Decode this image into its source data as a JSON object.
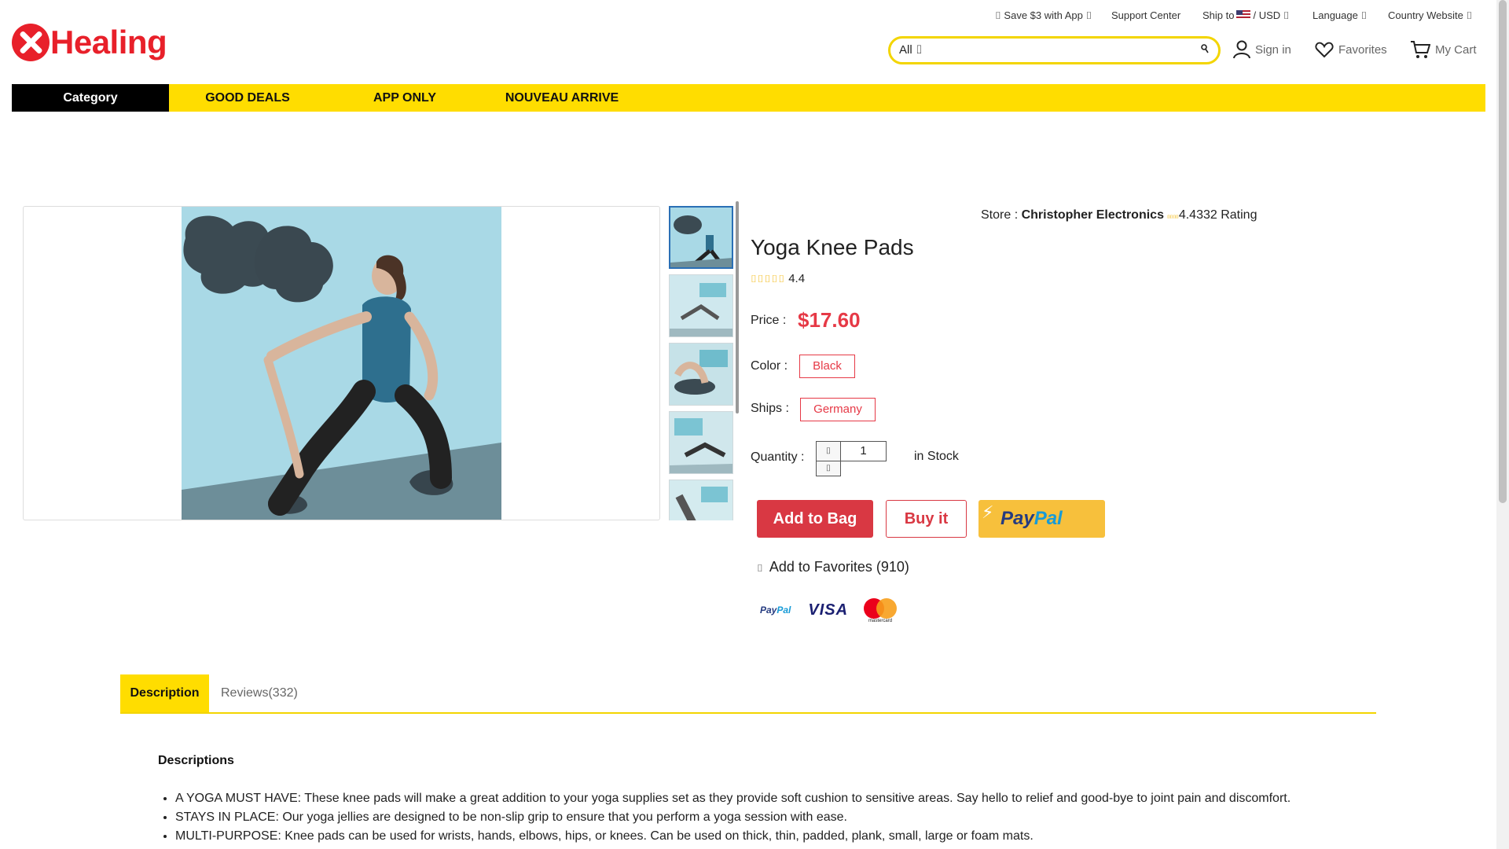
{
  "topbar": {
    "save_app": "⌷ Save $3 with App ⌷",
    "support": "Support Center",
    "ship_to_label": "Ship to",
    "currency": "/ USD ⌷",
    "language": "Language ⌷",
    "country_website": "Country Website ⌷"
  },
  "logo": {
    "text": "Healing"
  },
  "search": {
    "category": "All ⌷",
    "placeholder": "",
    "button_icon": "search-icon"
  },
  "header": {
    "sign_in": "Sign in",
    "favorites": "Favorites",
    "cart": "My Cart"
  },
  "nav": {
    "category": "Category",
    "items": [
      "GOOD DEALS",
      "APP ONLY",
      "NOUVEAU ARRIVE"
    ]
  },
  "store": {
    "prefix": "Store :",
    "name": "Christopher Electronics",
    "mini_stars": "⌷⌷⌷⌷",
    "rating_text": "4.4332 Rating"
  },
  "product": {
    "title": "Yoga Knee Pads",
    "stars": "⌷⌷⌷⌷⌷",
    "rating": "4.4",
    "price_label": "Price :",
    "price": "$17.60",
    "color_label": "Color :",
    "color_value": "Black",
    "ships_label": "Ships :",
    "ships_value": "Germany",
    "quantity_label": "Quantity :",
    "quantity_value": "1",
    "qty_up": "⌷",
    "qty_down": "⌷",
    "stock": "in Stock"
  },
  "actions": {
    "add_to_bag": "Add to Bag",
    "buy_it": "Buy it",
    "paypal_a": "Pay",
    "paypal_b": "Pal",
    "add_favorites": "Add to Favorites (910)",
    "fav_icon": "⌷"
  },
  "payments": {
    "paypal_a": "Pay",
    "paypal_b": "Pal",
    "visa": "VISA",
    "mastercard": "mastercard"
  },
  "tabs": {
    "description": "Description",
    "reviews": "Reviews(332)"
  },
  "description": {
    "heading": "Descriptions",
    "bullets": [
      "A YOGA MUST HAVE: These knee pads will make a great addition to your yoga supplies set as they provide soft cushion to sensitive areas. Say hello to relief and good-bye to joint pain and discomfort.",
      "STAYS IN PLACE: Our yoga jellies are designed to be non-slip grip to ensure that you perform a yoga session with ease.",
      "MULTI-PURPOSE: Knee pads can be used for wrists, hands, elbows, hips, or knees. Can be used on thick, thin, padded, plank, small, large or foam mats."
    ]
  },
  "colors": {
    "brand_red": "#e8202a",
    "nav_yellow": "#ffdd00",
    "price_red": "#e63946",
    "search_border": "#f3d500"
  }
}
